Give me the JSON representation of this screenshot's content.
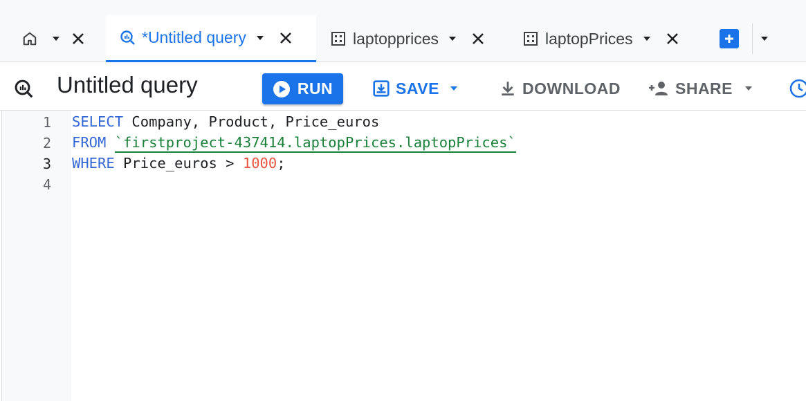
{
  "tabs": [
    {
      "name": "home",
      "label": "",
      "icon": "home-icon"
    },
    {
      "name": "untitled-query",
      "label": "*Untitled query",
      "icon": "query-icon",
      "active": true
    },
    {
      "name": "laptopprices",
      "label": "laptopprices",
      "icon": "table-icon"
    },
    {
      "name": "laptopPrices",
      "label": "laptopPrices",
      "icon": "table-icon"
    }
  ],
  "toolbar": {
    "title": "Untitled query",
    "run_label": "RUN",
    "save_label": "SAVE",
    "download_label": "DOWNLOAD",
    "share_label": "SHARE"
  },
  "editor": {
    "line_numbers": [
      "1",
      "2",
      "3",
      "4"
    ],
    "current_line": "3",
    "lines": [
      [
        {
          "t": "kw",
          "v": "SELECT"
        },
        {
          "t": "plain",
          "v": " Company, Product, Price_euros"
        }
      ],
      [
        {
          "t": "kw",
          "v": "FROM"
        },
        {
          "t": "plain",
          "v": " "
        },
        {
          "t": "str",
          "v": "`firstproject-437414.laptopPrices.laptopPrices`"
        }
      ],
      [
        {
          "t": "kw",
          "v": "WHERE"
        },
        {
          "t": "plain",
          "v": " Price_euros > "
        },
        {
          "t": "num",
          "v": "1000"
        },
        {
          "t": "plain",
          "v": ";"
        }
      ],
      []
    ]
  },
  "colors": {
    "accent": "#1a73e8",
    "keyword": "#3367d6",
    "string": "#188038",
    "number": "#e8543e",
    "muted": "#5f6368"
  }
}
